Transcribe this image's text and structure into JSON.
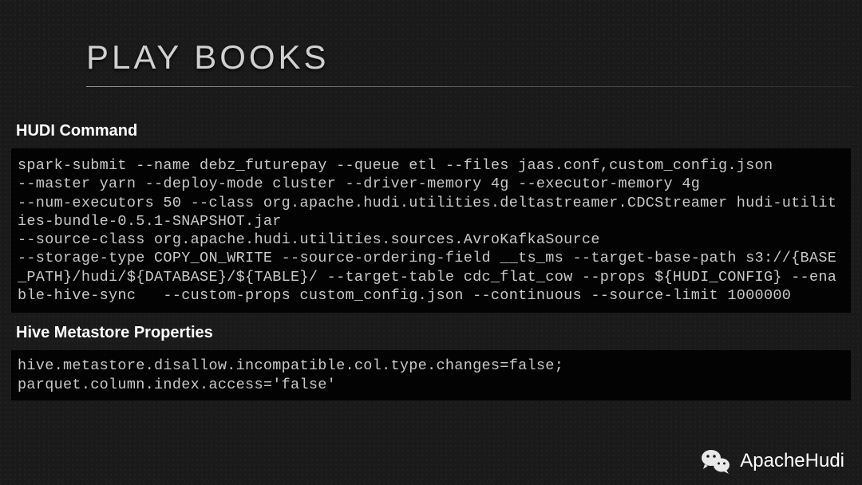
{
  "title": "PLAY BOOKS",
  "sections": {
    "hudi": {
      "label": "HUDI  Command",
      "code": "spark-submit --name debz_futurepay --queue etl --files jaas.conf,custom_config.json\n--master yarn --deploy-mode cluster --driver-memory 4g --executor-memory 4g\n--num-executors 50 --class org.apache.hudi.utilities.deltastreamer.CDCStreamer hudi-utilities-bundle-0.5.1-SNAPSHOT.jar\n--source-class org.apache.hudi.utilities.sources.AvroKafkaSource\n--storage-type COPY_ON_WRITE --source-ordering-field __ts_ms --target-base-path s3://{BASE_PATH}/hudi/${DATABASE}/${TABLE}/ --target-table cdc_flat_cow --props ${HUDI_CONFIG} --enable-hive-sync   --custom-props custom_config.json --continuous --source-limit 1000000"
    },
    "hive": {
      "label": "Hive Metastore Properties",
      "code": "hive.metastore.disallow.incompatible.col.type.changes=false;\nparquet.column.index.access='false'"
    }
  },
  "footer": {
    "brand": "ApacheHudi"
  }
}
